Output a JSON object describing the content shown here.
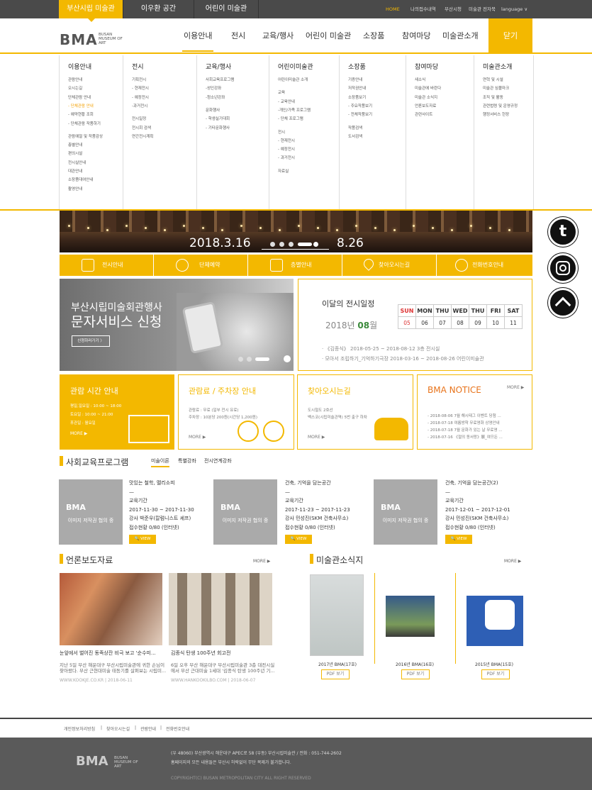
{
  "topbar": {
    "sites": [
      "부산시립 미술관",
      "이우환 공간",
      "어린이 미술관"
    ],
    "util": [
      "HOME",
      "나의접수내역",
      "부산시청",
      "미술관 전자북",
      "language ∨"
    ]
  },
  "header": {
    "logo": "BMA",
    "logo_sub": [
      "BUSAN",
      "MUSEUM OF",
      "ART"
    ],
    "gnb": [
      "이용안내",
      "전시",
      "교육/행사",
      "어린이 미술관",
      "소장품",
      "참여마당",
      "미술관소개"
    ],
    "close": "닫기"
  },
  "mega": [
    {
      "title": "이용안내",
      "items": [
        "관람안내",
        "오시는길",
        "단체관람 안내",
        "- 단체관람 안내",
        "- 예약현황 조회",
        "- 단체관람 작품하기",
        "관람예절 및 작품감상",
        "층별안내",
        "편의시설",
        "전시실안내",
        "대관안내",
        "소장품대여안내",
        "촬영안내"
      ]
    },
    {
      "title": "전시",
      "items": [
        "기획전시",
        "- 현재전시",
        "- 예정전시",
        "-과거전시",
        "전시일정",
        "전시회 검색",
        "연간전시계획"
      ]
    },
    {
      "title": "교육/행사",
      "items": [
        "사회교육프로그램",
        "-성인강좌",
        "-청소년강좌",
        "문화행사",
        "- 학생실기대회",
        "- 기타문화행사"
      ]
    },
    {
      "title": "어린이미술관",
      "items": [
        "어린이미술관 소개",
        "교육",
        "- 교육안내",
        "-개인/가족 프로그램",
        "- 단체 프로그램",
        "전시",
        "- 현재전시",
        "- 예정전시",
        "- 과거전시",
        "자료실"
      ]
    },
    {
      "title": "소장품",
      "items": [
        "기증안내",
        "저작권안내",
        "소장품보기",
        "- 주요작품보기",
        "- 전체작품보기",
        "작품검색",
        "도서검색"
      ]
    },
    {
      "title": "참여마당",
      "items": [
        "새소식",
        "미술관에 바란다",
        "미술관 소식지",
        "언론보도자료",
        "관련사이트"
      ]
    },
    {
      "title": "미술관소개",
      "items": [
        "연혁 및 시설",
        "미술관 심볼마크",
        "조직 및 활동",
        "관련법령 및 운영규정",
        "행정서비스 헌장"
      ]
    }
  ],
  "hero": {
    "start": "2018.3.16",
    "end": "8.26"
  },
  "quick": [
    "전시안내",
    "단체예약",
    "층별안내",
    "찾아오시는길",
    "전화번호안내"
  ],
  "sns": [
    "t",
    "instagram",
    "top"
  ],
  "promo": {
    "line1": "부산시립미술회관행사",
    "line2": "문자서비스 신청",
    "btn": "신청하러가기 〉"
  },
  "schedule": {
    "title": "이달의 전시일정",
    "year": "2018년",
    "month": "08",
    "month_suffix": "월",
    "days_header": [
      "SUN",
      "MON",
      "THU",
      "WED",
      "THU",
      "FRI",
      "SAT"
    ],
    "days": [
      "05",
      "06",
      "07",
      "08",
      "09",
      "10",
      "11"
    ],
    "items": [
      "· 《김종식》 2018-05-25 ~ 2018-08-12 3층 전시실",
      "· 모아서 조립하기_기억하기극장 2018-03-16 ~ 2018-08-26 어린이미술관"
    ]
  },
  "info": {
    "hours": {
      "title": "관람 시간 안내",
      "lines": [
        "평일,일요일 : 10:00 ~ 18:00",
        "토요일 : 10:00 ~ 21:00",
        "휴관일 : 월요일"
      ],
      "more": "MORE ▶"
    },
    "fee": {
      "title": "관람료 / 주차장 안내",
      "lines": [
        "관람료 : 무료 (일부 전시 유료)",
        "주차장 : 10분당 200원(시간당 1,200원)"
      ],
      "more": "MORE ▶"
    },
    "map": {
      "title": "찾아오시는길",
      "lines": [
        "도시철도 2호선",
        "벡스코(시립미술관역) 5번 출구 하차"
      ],
      "more": "MORE ▶"
    },
    "notice": {
      "title": "BMA NOTICE",
      "more": "MORE ▶",
      "items": [
        "- 2018-08-06 7월 해시태그 이벤트 당첨 ...",
        "- 2018-07-18 여름방학 무료영화 상영안내",
        "- 2018-07-18 7월 문화가 있는 날 무료영 ...",
        "- 2018-07-16 《절의 동서랑》展_여므든 ..."
      ]
    }
  },
  "edu": {
    "title": "사회교육프로그램",
    "tabs": [
      "미술이론",
      "특별강좌",
      "전시연계강좌"
    ],
    "placeholder": "이미지 저작권 협의 중",
    "logo": "BMA",
    "view": "VIEW",
    "cards": [
      {
        "title": "맛있는 철학, 멜리소피",
        "dash": "—",
        "label": "교육기간",
        "period": "2017-11-30 ~ 2017-11-30",
        "lecturer": "강사 박준우(칼럼니스트 셰프)",
        "status": "접수현황 0/80 (인터넷)"
      },
      {
        "title": "건축, 기억을 담는공간",
        "dash": "—",
        "label": "교육기간",
        "period": "2017-11-23 ~ 2017-11-23",
        "lecturer": "강사 민성진(SKM 건축사무소)",
        "status": "접수현황 0/80 (인터넷)"
      },
      {
        "title": "건축, 기억을 담는공간(2)",
        "dash": "—",
        "label": "교육기간",
        "period": "2017-12-01 ~ 2017-12-01",
        "lecturer": "강사 민성진(SKM 건축사무소)",
        "status": "접수현황 0/80 (인터넷)"
      }
    ]
  },
  "press": {
    "title": "언론보도자료",
    "more": "MORE ▶",
    "items": [
      {
        "title": "눈앞에서 벌어진 동족상잔 비극 보고 '순수미...",
        "desc": [
          "지난 5일 부산 해운대구 부산시립미술관에 귀한 손님이",
          "찾아왔다. 부산 근현대미술 태동기를 살펴보는 시립미..."
        ],
        "src": "WWW.KOOKJE.CO.KR  |  2018-06-11"
      },
      {
        "title": "김종식 탄생 100주년 회고전",
        "desc": [
          "6일 오후 부산 해운대구 부산시립미술관 3층 대전시실",
          "에서 부산 근대미술 1세대 '김종식 탄생 100주년 기..."
        ],
        "src": "WWW.HANKOOKILBO.COM  |  2018-06-07"
      }
    ]
  },
  "news": {
    "title": "미술관소식지",
    "more": "MORE ▶",
    "items": [
      {
        "label": "2017년 BMA(17호)",
        "btn": "PDF 보기"
      },
      {
        "label": "2016년 BMA(16호)",
        "btn": "PDF 보기"
      },
      {
        "label": "2015년 BMA(15호)",
        "btn": "PDF 보기"
      }
    ]
  },
  "footer": {
    "links": [
      "개인정보처리방침",
      "찾아오시는길",
      "관람안내",
      "전화번호안내"
    ],
    "address": "(우 48060) 부산광역시 해운대구 APEC로 58 (우동) 부산시립미술관 / 전화 : 051-744-2602",
    "notice": "홈페이지의 모든 내용들은 부산시 허락없이 무단 복제가 불가합니다.",
    "copyright": "COPYRIGHT(C) BUSAN METROPOLITAN CITY ALL RIGHT RESERVED",
    "logo": "BMA"
  },
  "colors": {
    "accent": "#f3b800",
    "dark": "#4a4a4a",
    "footer": "#5a5a5a"
  }
}
